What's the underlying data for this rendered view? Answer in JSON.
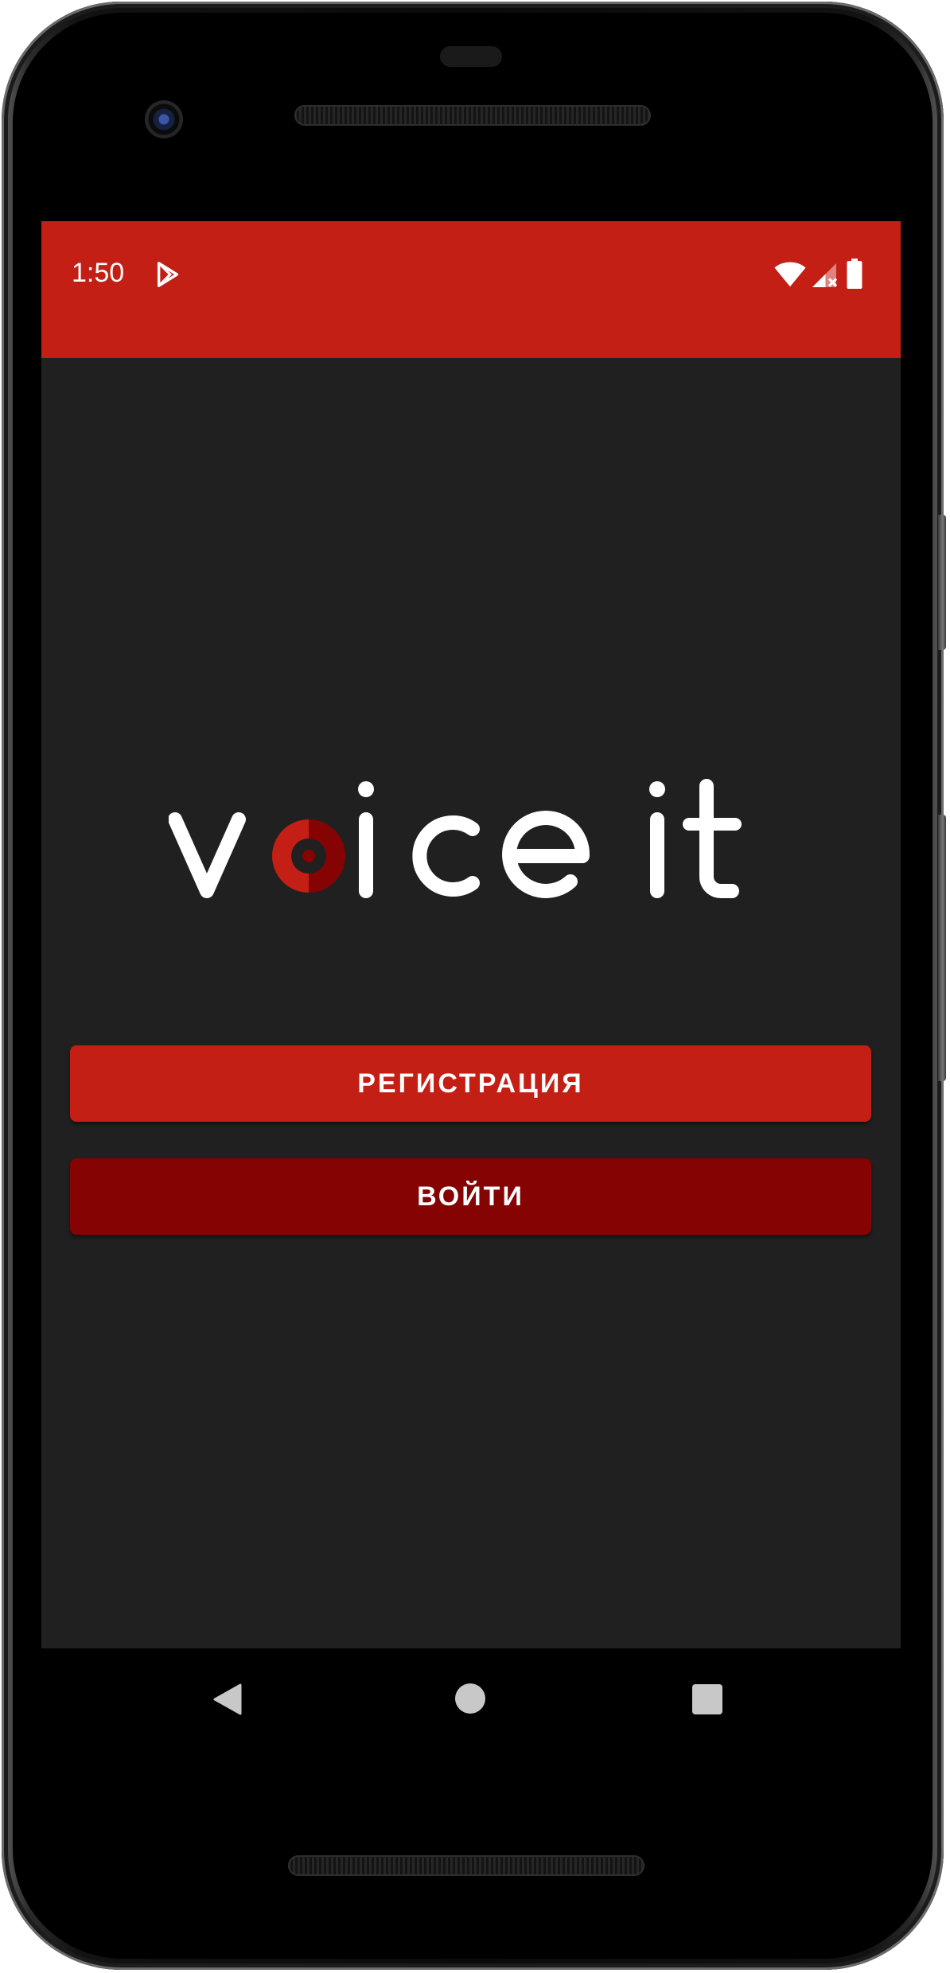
{
  "status_bar": {
    "time": "1:50",
    "background_color": "#c31f15",
    "icons": [
      "play-store-icon",
      "wifi-icon",
      "cellular-signal-icon",
      "battery-icon"
    ]
  },
  "logo": {
    "text": "voice it",
    "text_color": "#ffffff",
    "accent_colors": [
      "#c31f15",
      "#850303"
    ]
  },
  "buttons": {
    "register_label": "РЕГИСТРАЦИЯ",
    "register_color": "#c31f15",
    "login_label": "ВОЙТИ",
    "login_color": "#850303"
  },
  "screen": {
    "background_color": "#202020"
  },
  "nav_bar": {
    "icons": [
      "back-icon",
      "home-icon",
      "recent-apps-icon"
    ]
  }
}
